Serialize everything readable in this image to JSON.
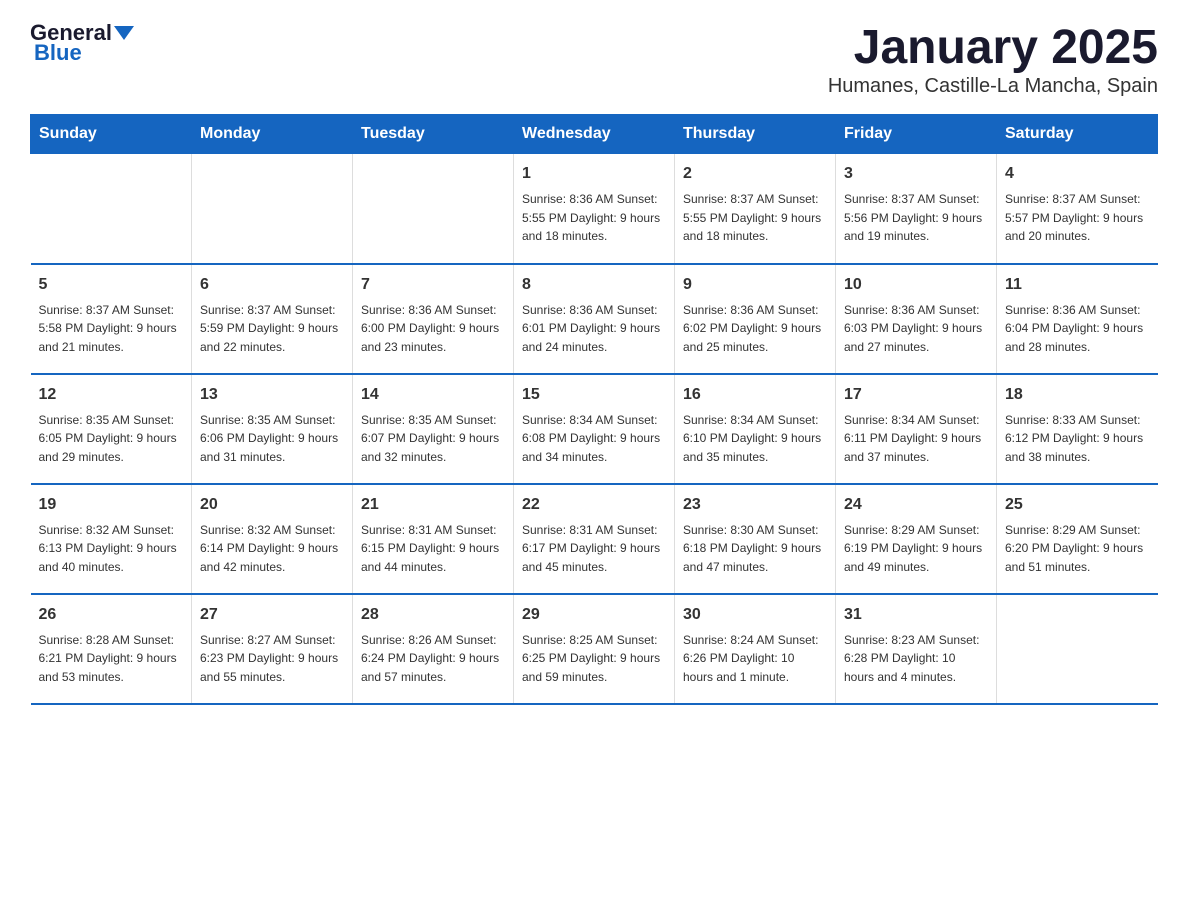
{
  "header": {
    "logo_general": "General",
    "logo_blue": "Blue",
    "month_title": "January 2025",
    "subtitle": "Humanes, Castille-La Mancha, Spain"
  },
  "weekdays": [
    "Sunday",
    "Monday",
    "Tuesday",
    "Wednesday",
    "Thursday",
    "Friday",
    "Saturday"
  ],
  "weeks": [
    [
      {
        "day": "",
        "info": ""
      },
      {
        "day": "",
        "info": ""
      },
      {
        "day": "",
        "info": ""
      },
      {
        "day": "1",
        "info": "Sunrise: 8:36 AM\nSunset: 5:55 PM\nDaylight: 9 hours\nand 18 minutes."
      },
      {
        "day": "2",
        "info": "Sunrise: 8:37 AM\nSunset: 5:55 PM\nDaylight: 9 hours\nand 18 minutes."
      },
      {
        "day": "3",
        "info": "Sunrise: 8:37 AM\nSunset: 5:56 PM\nDaylight: 9 hours\nand 19 minutes."
      },
      {
        "day": "4",
        "info": "Sunrise: 8:37 AM\nSunset: 5:57 PM\nDaylight: 9 hours\nand 20 minutes."
      }
    ],
    [
      {
        "day": "5",
        "info": "Sunrise: 8:37 AM\nSunset: 5:58 PM\nDaylight: 9 hours\nand 21 minutes."
      },
      {
        "day": "6",
        "info": "Sunrise: 8:37 AM\nSunset: 5:59 PM\nDaylight: 9 hours\nand 22 minutes."
      },
      {
        "day": "7",
        "info": "Sunrise: 8:36 AM\nSunset: 6:00 PM\nDaylight: 9 hours\nand 23 minutes."
      },
      {
        "day": "8",
        "info": "Sunrise: 8:36 AM\nSunset: 6:01 PM\nDaylight: 9 hours\nand 24 minutes."
      },
      {
        "day": "9",
        "info": "Sunrise: 8:36 AM\nSunset: 6:02 PM\nDaylight: 9 hours\nand 25 minutes."
      },
      {
        "day": "10",
        "info": "Sunrise: 8:36 AM\nSunset: 6:03 PM\nDaylight: 9 hours\nand 27 minutes."
      },
      {
        "day": "11",
        "info": "Sunrise: 8:36 AM\nSunset: 6:04 PM\nDaylight: 9 hours\nand 28 minutes."
      }
    ],
    [
      {
        "day": "12",
        "info": "Sunrise: 8:35 AM\nSunset: 6:05 PM\nDaylight: 9 hours\nand 29 minutes."
      },
      {
        "day": "13",
        "info": "Sunrise: 8:35 AM\nSunset: 6:06 PM\nDaylight: 9 hours\nand 31 minutes."
      },
      {
        "day": "14",
        "info": "Sunrise: 8:35 AM\nSunset: 6:07 PM\nDaylight: 9 hours\nand 32 minutes."
      },
      {
        "day": "15",
        "info": "Sunrise: 8:34 AM\nSunset: 6:08 PM\nDaylight: 9 hours\nand 34 minutes."
      },
      {
        "day": "16",
        "info": "Sunrise: 8:34 AM\nSunset: 6:10 PM\nDaylight: 9 hours\nand 35 minutes."
      },
      {
        "day": "17",
        "info": "Sunrise: 8:34 AM\nSunset: 6:11 PM\nDaylight: 9 hours\nand 37 minutes."
      },
      {
        "day": "18",
        "info": "Sunrise: 8:33 AM\nSunset: 6:12 PM\nDaylight: 9 hours\nand 38 minutes."
      }
    ],
    [
      {
        "day": "19",
        "info": "Sunrise: 8:32 AM\nSunset: 6:13 PM\nDaylight: 9 hours\nand 40 minutes."
      },
      {
        "day": "20",
        "info": "Sunrise: 8:32 AM\nSunset: 6:14 PM\nDaylight: 9 hours\nand 42 minutes."
      },
      {
        "day": "21",
        "info": "Sunrise: 8:31 AM\nSunset: 6:15 PM\nDaylight: 9 hours\nand 44 minutes."
      },
      {
        "day": "22",
        "info": "Sunrise: 8:31 AM\nSunset: 6:17 PM\nDaylight: 9 hours\nand 45 minutes."
      },
      {
        "day": "23",
        "info": "Sunrise: 8:30 AM\nSunset: 6:18 PM\nDaylight: 9 hours\nand 47 minutes."
      },
      {
        "day": "24",
        "info": "Sunrise: 8:29 AM\nSunset: 6:19 PM\nDaylight: 9 hours\nand 49 minutes."
      },
      {
        "day": "25",
        "info": "Sunrise: 8:29 AM\nSunset: 6:20 PM\nDaylight: 9 hours\nand 51 minutes."
      }
    ],
    [
      {
        "day": "26",
        "info": "Sunrise: 8:28 AM\nSunset: 6:21 PM\nDaylight: 9 hours\nand 53 minutes."
      },
      {
        "day": "27",
        "info": "Sunrise: 8:27 AM\nSunset: 6:23 PM\nDaylight: 9 hours\nand 55 minutes."
      },
      {
        "day": "28",
        "info": "Sunrise: 8:26 AM\nSunset: 6:24 PM\nDaylight: 9 hours\nand 57 minutes."
      },
      {
        "day": "29",
        "info": "Sunrise: 8:25 AM\nSunset: 6:25 PM\nDaylight: 9 hours\nand 59 minutes."
      },
      {
        "day": "30",
        "info": "Sunrise: 8:24 AM\nSunset: 6:26 PM\nDaylight: 10 hours\nand 1 minute."
      },
      {
        "day": "31",
        "info": "Sunrise: 8:23 AM\nSunset: 6:28 PM\nDaylight: 10 hours\nand 4 minutes."
      },
      {
        "day": "",
        "info": ""
      }
    ]
  ]
}
